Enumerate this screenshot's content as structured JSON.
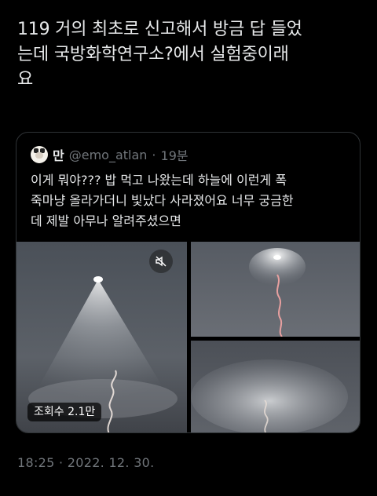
{
  "tweet": {
    "text": "119 거의 최초로 신고해서 방금 답 들었\n는데 국방화학연구소?에서 실험중이래\n요",
    "meta": "18:25 · 2022. 12. 30."
  },
  "quote": {
    "name": "만",
    "handle": "@emo_atlan",
    "dot": "·",
    "time": "19분",
    "text": "이게 뭐야??? 밥 먹고 나왔는데 하늘에 이런게 폭\n죽마냥 올라가더니 빛났다 사라졌어요 너무 궁금한\n데 제발 아무나 알려주셨으면",
    "avatar_icon": "cat-avatar-icon",
    "views_label": "조회수 2.1만",
    "mute_icon": "mute-icon"
  },
  "colors": {
    "background": "#000000",
    "text": "#e7e9ea",
    "secondary": "#71767b",
    "border": "#2f3336"
  }
}
